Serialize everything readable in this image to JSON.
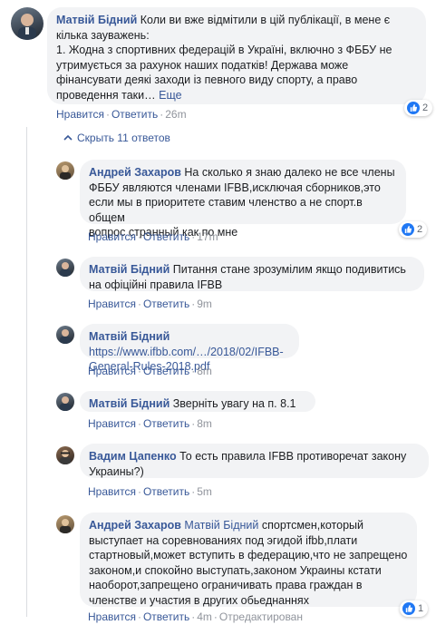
{
  "main_comment": {
    "author": "Матвій Бідний",
    "text_lines": [
      "Коли ви вже відмітили в цій публікації, в мене є",
      "кілька зауважень:",
      "1. Жодна з спортивних федерацій в Україні, включно з ФББУ не",
      "утримується за рахунок наших податків! Держава може",
      "фінансувати деякі заходи із певного виду спорту, а право",
      "проведення таки…"
    ],
    "more_label": "Еще",
    "like_label": "Нравится",
    "reply_label": "Ответить",
    "time": "26m",
    "reactions": "2"
  },
  "hide_replies_label": "Скрыть 11 ответов",
  "replies": [
    {
      "author": "Андрей Захаров",
      "lines": [
        "На сколько я знаю далеко не все члены",
        "ФББУ являются членами IFBB,исключая сборников,это",
        "если мы в приоритете ставим членство а не спорт.в общем",
        "вопрос странный как по мне"
      ],
      "like_label": "Нравится",
      "reply_label": "Ответить",
      "time": "17m",
      "reactions": "2"
    },
    {
      "author": "Матвій Бідний",
      "lines": [
        "Питання стане зрозумілим якщо подивитись",
        "на офіційні правила IFBB"
      ],
      "like_label": "Нравится",
      "reply_label": "Ответить",
      "time": "9m"
    },
    {
      "author": "Матвій Бідний",
      "lines": [
        "https://www.ifbb.com/…/2018/02/IFBB-",
        "General-Rules-2018.pdf"
      ],
      "like_label": "Нравится",
      "reply_label": "Ответить",
      "time": "8m"
    },
    {
      "author": "Матвій Бідний",
      "lines": [
        "Зверніть увагу на п. 8.1"
      ],
      "like_label": "Нравится",
      "reply_label": "Ответить",
      "time": "8m"
    },
    {
      "author": "Вадим Цапенко",
      "lines": [
        "То есть правила IFBB противоречат закону",
        "Украины?)"
      ],
      "like_label": "Нравится",
      "reply_label": "Ответить",
      "time": "5m"
    },
    {
      "author": "Андрей Захаров",
      "mention": "Матвій Бідний",
      "lines": [
        "спортсмен,который",
        "выступает на соревнованиях под эгидой ifbb,плати",
        "стартновый,может вступить в федерацию,что не запрещено",
        "законом,и спокойно выступать,законом Украины кстати",
        "наоборот,запрещено ограничивать права граждан в",
        "членстве и участия в других обьеднаннях"
      ],
      "like_label": "Нравится",
      "reply_label": "Ответить",
      "time": "4m",
      "edited_label": "Отредактирован",
      "reactions": "1"
    }
  ],
  "colors": {
    "link": "#385898",
    "bubble": "#f2f3f5",
    "meta": "#90949c",
    "like_badge": "#2078f4"
  }
}
